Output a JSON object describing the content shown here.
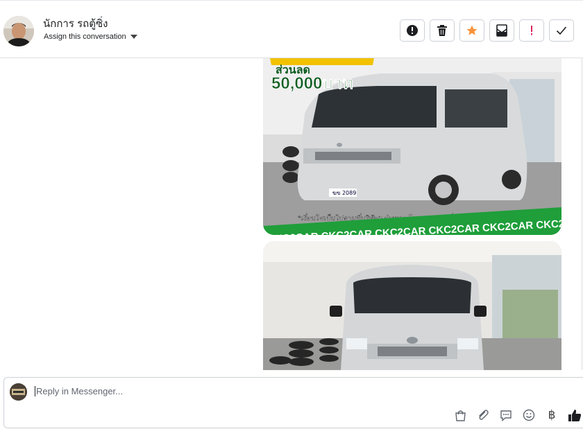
{
  "header": {
    "contact_name": "นักการ รถตู้ซิ่ง",
    "assign_label": "Assign this conversation"
  },
  "actions": [
    {
      "name": "alert-circle-icon"
    },
    {
      "name": "trash-icon"
    },
    {
      "name": "star-icon"
    },
    {
      "name": "archive-envelope-icon"
    },
    {
      "name": "exclamation-icon"
    },
    {
      "name": "check-icon"
    }
  ],
  "thread": {
    "photo1": {
      "promo_line1": "ส่วนลด",
      "promo_amount": "50,000บาท",
      "caption": "*เงื่อนไขเป็นไปตามที่บริษัทฯ กำหนด โทรสอบถามเพิ่มเติมได้ที่ 088-5577932",
      "banner": "CKC2CAR CKC2CAR CKC2CAR CKC2CAR CKC2CAR CKC2",
      "plate": "ฆข 2089"
    }
  },
  "composer": {
    "placeholder": "Reply in Messenger..."
  },
  "tools": [
    {
      "name": "shopping-bag-icon"
    },
    {
      "name": "paperclip-icon"
    },
    {
      "name": "chat-bubble-icon"
    },
    {
      "name": "smiley-icon"
    },
    {
      "name": "baht-icon",
      "glyph": "฿"
    },
    {
      "name": "thumbs-up-icon"
    }
  ],
  "colors": {
    "star": "#f7923a",
    "exclamation": "#e0245e",
    "banner_green": "#1f9e3a"
  }
}
